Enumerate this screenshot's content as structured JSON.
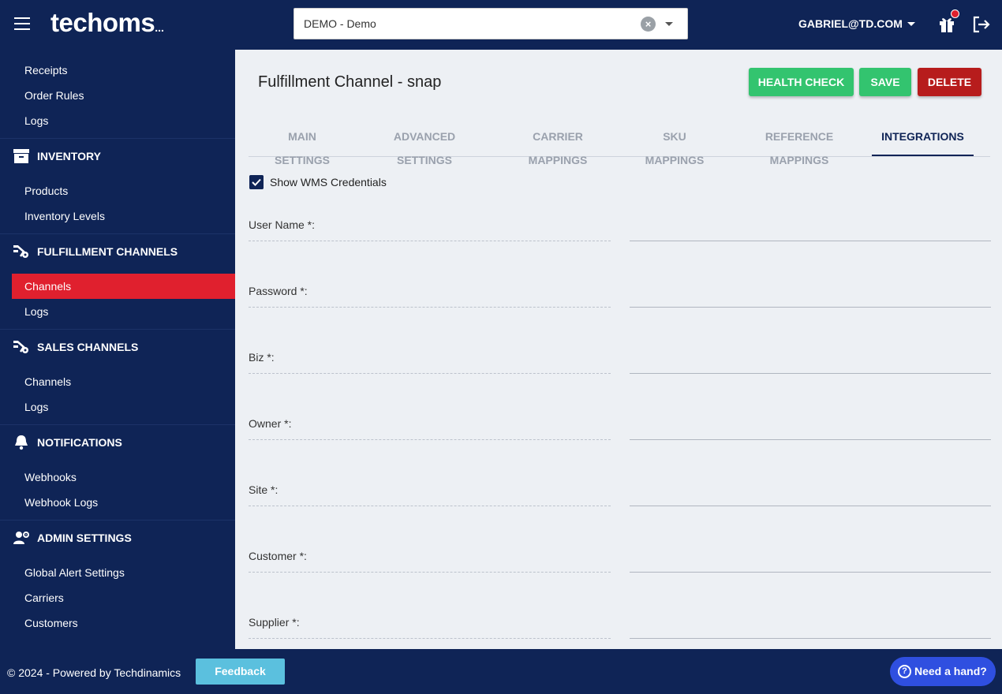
{
  "header": {
    "logo_text": "techoms",
    "logo_suffix": "...",
    "tenant_value": "DEMO - Demo",
    "user_label": "GABRIEL@TD.COM"
  },
  "sidebar": {
    "links_top": [
      "Receipts",
      "Order Rules",
      "Logs"
    ],
    "inventory": {
      "label": "INVENTORY",
      "items": [
        "Products",
        "Inventory Levels"
      ]
    },
    "fulfillment": {
      "label": "FULFILLMENT CHANNELS",
      "items": [
        "Channels",
        "Logs"
      ],
      "active": "Channels"
    },
    "sales": {
      "label": "SALES CHANNELS",
      "items": [
        "Channels",
        "Logs"
      ]
    },
    "notifications": {
      "label": "NOTIFICATIONS",
      "items": [
        "Webhooks",
        "Webhook Logs"
      ]
    },
    "admin": {
      "label": "ADMIN SETTINGS",
      "items": [
        "Global Alert Settings",
        "Carriers",
        "Customers"
      ]
    }
  },
  "main": {
    "title": "Fulfillment Channel - snap",
    "buttons": {
      "health": "HEALTH CHECK",
      "save": "SAVE",
      "delete": "DELETE"
    },
    "tabs": [
      "MAIN SETTINGS",
      "ADVANCED SETTINGS",
      "CARRIER MAPPINGS",
      "SKU MAPPINGS",
      "REFERENCE MAPPINGS",
      "INTEGRATIONS"
    ],
    "active_tab": "INTEGRATIONS",
    "show_credentials_label": "Show WMS Credentials",
    "show_credentials_checked": true,
    "fields": [
      {
        "label": "User Name *:",
        "value": ""
      },
      {
        "label": "Password *:",
        "value": ""
      },
      {
        "label": "Biz *:",
        "value": ""
      },
      {
        "label": "Owner *:",
        "value": ""
      },
      {
        "label": "Site *:",
        "value": ""
      },
      {
        "label": "Customer *:",
        "value": ""
      },
      {
        "label": "Supplier *:",
        "value": ""
      }
    ]
  },
  "footer": {
    "copyright": "© 2024 - Powered by Techdinamics",
    "feedback_label": "Feedback",
    "help_label": "Need a hand?"
  },
  "colors": {
    "navy": "#0f2456",
    "accent_red": "#e0202e",
    "green": "#33c46f",
    "delete_red": "#b71c1c",
    "feedback_blue": "#5bc0de",
    "help_blue": "#2f4fe0"
  }
}
